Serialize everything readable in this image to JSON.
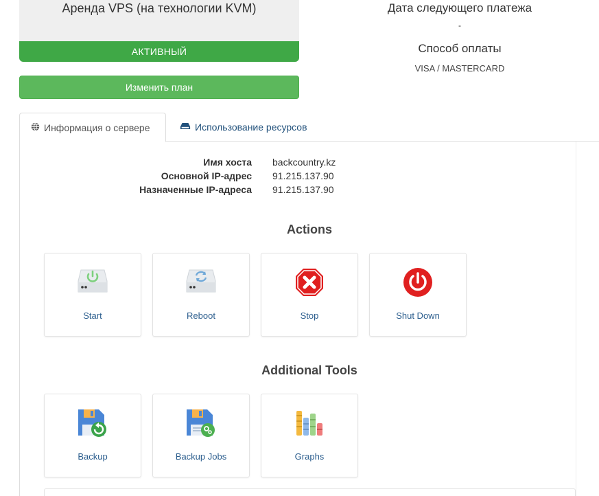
{
  "plan": {
    "title": "Аренда VPS (на технологии KVM)",
    "status": "АКТИВНЫЙ",
    "change_plan_label": "Изменить план"
  },
  "payment": {
    "next_payment_label": "Дата следующего платежа",
    "next_payment_value": "-",
    "method_label": "Способ оплаты",
    "method_value": "VISA / MASTERCARD"
  },
  "tabs": [
    {
      "label": "Информация о сервере",
      "icon": "globe-icon",
      "active": true
    },
    {
      "label": "Использование ресурсов",
      "icon": "hdd-icon",
      "active": false
    }
  ],
  "server_info": [
    {
      "label": "Имя хоста",
      "value": "backcountry.kz"
    },
    {
      "label": "Основной IP-адрес",
      "value": "91.215.137.90"
    },
    {
      "label": "Назначенные IP-адреса",
      "value": "91.215.137.90"
    }
  ],
  "actions": {
    "title": "Actions",
    "items": [
      {
        "label": "Start",
        "icon": "server-power-icon"
      },
      {
        "label": "Reboot",
        "icon": "server-reboot-icon"
      },
      {
        "label": "Stop",
        "icon": "stop-sign-icon"
      },
      {
        "label": "Shut Down",
        "icon": "power-icon"
      }
    ]
  },
  "tools": {
    "title": "Additional Tools",
    "items": [
      {
        "label": "Backup",
        "icon": "floppy-restore-icon"
      },
      {
        "label": "Backup Jobs",
        "icon": "floppy-gear-icon"
      },
      {
        "label": "Graphs",
        "icon": "bar-graph-icon"
      }
    ]
  },
  "colors": {
    "status_green": "#3fa846",
    "button_green": "#5cb85c",
    "link_blue": "#2c5e8e",
    "stop_red": "#e02020"
  }
}
